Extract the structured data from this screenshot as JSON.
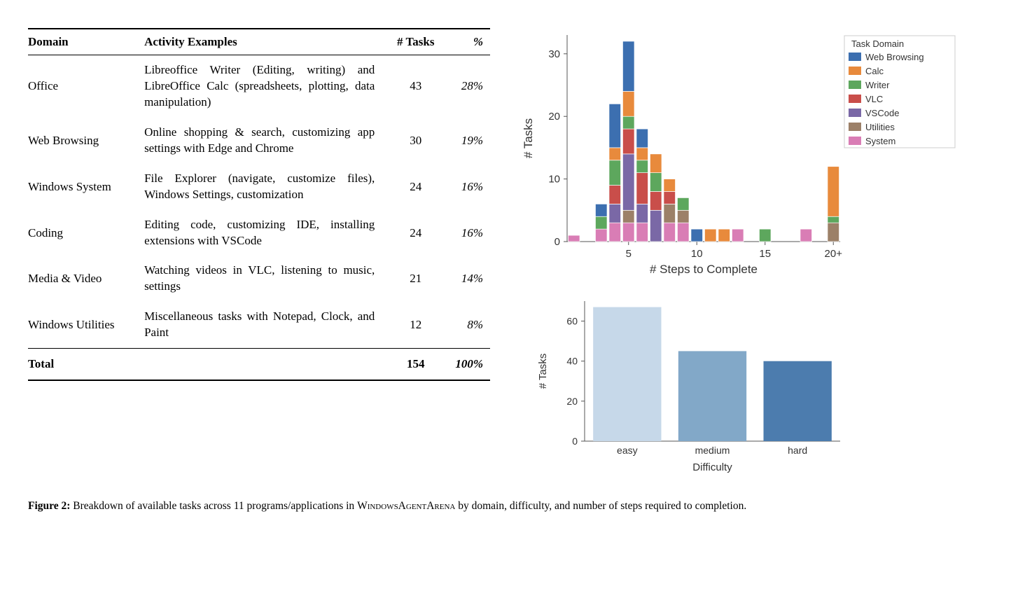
{
  "table": {
    "headers": {
      "domain": "Domain",
      "examples": "Activity Examples",
      "tasks": "# Tasks",
      "pct": "%"
    },
    "rows": [
      {
        "domain": "Office",
        "examples": "Libreoffice Writer (Editing, writing) and LibreOffice Calc (spreadsheets, plotting, data manipulation)",
        "tasks": "43",
        "pct": "28%"
      },
      {
        "domain": "Web Browsing",
        "examples": "Online shopping & search, customizing app settings with Edge and Chrome",
        "tasks": "30",
        "pct": "19%"
      },
      {
        "domain": "Windows System",
        "examples": "File Explorer (navigate, customize files), Windows Settings, customization",
        "tasks": "24",
        "pct": "16%"
      },
      {
        "domain": "Coding",
        "examples": "Editing code, customizing IDE, installing extensions with VSCode",
        "tasks": "24",
        "pct": "16%"
      },
      {
        "domain": "Media & Video",
        "examples": "Watching videos in VLC, listening to music, settings",
        "tasks": "21",
        "pct": "14%"
      },
      {
        "domain": "Windows Utilities",
        "examples": "Miscellaneous tasks with Notepad, Clock, and Paint",
        "tasks": "12",
        "pct": "8%"
      }
    ],
    "total": {
      "domain": "Total",
      "examples": "",
      "tasks": "154",
      "pct": "100%"
    }
  },
  "chart_data": [
    {
      "type": "bar-stacked",
      "title": "",
      "xlabel": "# Steps to Complete",
      "ylabel": "# Tasks",
      "x_ticks": [
        5,
        10,
        15,
        "20+"
      ],
      "yticks": [
        0,
        10,
        20,
        30
      ],
      "ylim": [
        0,
        33
      ],
      "categories": [
        1,
        2,
        3,
        4,
        5,
        6,
        7,
        8,
        9,
        10,
        11,
        12,
        13,
        14,
        15,
        16,
        17,
        18,
        19,
        20
      ],
      "series": [
        {
          "name": "Web Browsing",
          "color": "#3C6FB0",
          "values": [
            0,
            0,
            2,
            7,
            8,
            3,
            0,
            0,
            0,
            2,
            0,
            0,
            0,
            0,
            0,
            0,
            0,
            0,
            0,
            0
          ]
        },
        {
          "name": "Calc",
          "color": "#E88A3C",
          "values": [
            0,
            0,
            0,
            2,
            4,
            2,
            3,
            2,
            0,
            0,
            2,
            2,
            0,
            0,
            0,
            0,
            0,
            0,
            0,
            8
          ]
        },
        {
          "name": "Writer",
          "color": "#5DA75D",
          "values": [
            0,
            0,
            2,
            4,
            2,
            2,
            3,
            0,
            2,
            0,
            0,
            0,
            0,
            0,
            2,
            0,
            0,
            0,
            0,
            1
          ]
        },
        {
          "name": "VLC",
          "color": "#C94E4A",
          "values": [
            0,
            0,
            0,
            3,
            4,
            5,
            3,
            2,
            0,
            0,
            0,
            0,
            0,
            0,
            0,
            0,
            0,
            0,
            0,
            0
          ]
        },
        {
          "name": "VSCode",
          "color": "#7A68A6",
          "values": [
            0,
            0,
            0,
            3,
            9,
            3,
            5,
            0,
            0,
            0,
            0,
            0,
            0,
            0,
            0,
            0,
            0,
            0,
            0,
            0
          ]
        },
        {
          "name": "Utilities",
          "color": "#9C8068",
          "values": [
            0,
            0,
            0,
            0,
            2,
            0,
            0,
            3,
            2,
            0,
            0,
            0,
            0,
            0,
            0,
            0,
            0,
            0,
            0,
            3
          ]
        },
        {
          "name": "System",
          "color": "#D97DB5",
          "values": [
            1,
            0,
            2,
            3,
            3,
            3,
            0,
            3,
            3,
            0,
            0,
            0,
            2,
            0,
            0,
            0,
            0,
            2,
            0,
            0
          ]
        }
      ],
      "legend_title": "Task Domain",
      "legend": [
        "Web Browsing",
        "Calc",
        "Writer",
        "VLC",
        "VSCode",
        "Utilities",
        "System"
      ]
    },
    {
      "type": "bar",
      "title": "",
      "xlabel": "Difficulty",
      "ylabel": "# Tasks",
      "yticks": [
        0,
        20,
        40,
        60
      ],
      "ylim": [
        0,
        70
      ],
      "categories": [
        "easy",
        "medium",
        "hard"
      ],
      "values": [
        67,
        45,
        40
      ],
      "colors": [
        "#C6D8E9",
        "#82A8C8",
        "#4C7CAE"
      ]
    }
  ],
  "caption": {
    "fig_label": "Figure 2:",
    "text_pre": " Breakdown of available tasks across 11 programs/applications in ",
    "arena": "WindowsAgentArena",
    "text_post": " by domain, difficulty, and number of steps required to completion."
  }
}
